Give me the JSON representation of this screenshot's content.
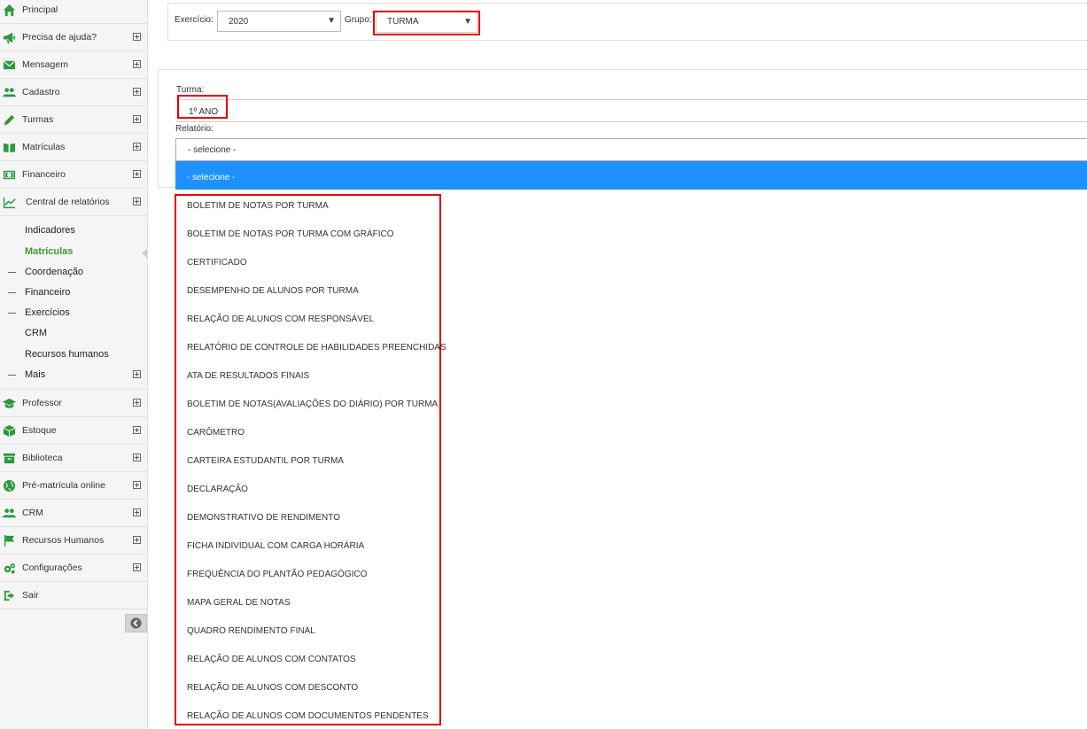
{
  "sidebar": {
    "items": [
      {
        "label": "Principal",
        "icon": "home-icon",
        "expandable": false
      },
      {
        "label": "Precisa de ajuda?",
        "icon": "megaphone-icon",
        "expandable": true
      },
      {
        "label": "Mensagem",
        "icon": "envelope-icon",
        "expandable": true
      },
      {
        "label": "Cadastro",
        "icon": "users-icon",
        "expandable": true
      },
      {
        "label": "Turmas",
        "icon": "pencil-icon",
        "expandable": true
      },
      {
        "label": "Matrículas",
        "icon": "book-icon",
        "expandable": true
      },
      {
        "label": "Financeiro",
        "icon": "money-icon",
        "expandable": true
      },
      {
        "label": "Central de relatórios",
        "icon": "line-chart-icon",
        "expandable": true
      }
    ],
    "subitems": [
      {
        "label": "Indicadores",
        "active": false,
        "dash": false
      },
      {
        "label": "Matrículas",
        "active": true,
        "dash": false
      },
      {
        "label": "Coordenação",
        "active": false,
        "dash": true
      },
      {
        "label": "Financeiro",
        "active": false,
        "dash": true
      },
      {
        "label": "Exercícios",
        "active": false,
        "dash": true
      },
      {
        "label": "CRM",
        "active": false,
        "dash": false
      },
      {
        "label": "Recursos humanos",
        "active": false,
        "dash": false
      },
      {
        "label": "Mais",
        "active": false,
        "dash": true
      }
    ],
    "items_bottom": [
      {
        "label": "Professor",
        "icon": "graduation-cap-icon",
        "expandable": true
      },
      {
        "label": "Estoque",
        "icon": "cube-icon",
        "expandable": true
      },
      {
        "label": "Biblioteca",
        "icon": "archive-icon",
        "expandable": true
      },
      {
        "label": "Pré-matrícula online",
        "icon": "globe-icon",
        "expandable": true
      },
      {
        "label": "CRM",
        "icon": "users-icon",
        "expandable": true
      },
      {
        "label": "Recursos Humanos",
        "icon": "flag-icon",
        "expandable": true
      },
      {
        "label": "Configurações",
        "icon": "gears-icon",
        "expandable": true
      },
      {
        "label": "Sair",
        "icon": "sign-out-icon",
        "expandable": false
      }
    ]
  },
  "filters": {
    "exercicio_label": "Exercício:",
    "exercicio_value": "2020",
    "grupo_label": "Grupo:",
    "grupo_value": "TURMA"
  },
  "form": {
    "turma_label": "Turma:",
    "turma_value": "1º ANO",
    "relatorio_label": "Relatório:",
    "relatorio_value": "- selecione -"
  },
  "dropdown": {
    "selected": "- selecione -",
    "options": [
      "BOLETIM DE NOTAS POR TURMA",
      "BOLETIM DE NOTAS POR TURMA COM GRÁFICO",
      "CERTIFICADO",
      "DESEMPENHO DE ALUNOS POR TURMA",
      "RELAÇÃO DE ALUNOS COM RESPONSÁVEL",
      "RELATÓRIO DE CONTROLE DE HABILIDADES PREENCHIDAS",
      "ATA DE RESULTADOS FINAIS",
      "BOLETIM DE NOTAS(AVALIAÇÕES DO DIÁRIO) POR TURMA",
      "CARÔMETRO",
      "CARTEIRA ESTUDANTIL POR TURMA",
      "DECLARAÇÃO",
      "DEMONSTRATIVO DE RENDIMENTO",
      "FICHA INDIVIDUAL COM CARGA HORÁRIA",
      "FREQUÊNCIA DO PLANTÃO PEDAGÓGICO",
      "MAPA GERAL DE NOTAS",
      "QUADRO RENDIMENTO FINAL",
      "RELAÇÃO DE ALUNOS COM CONTATOS",
      "RELAÇÃO DE ALUNOS COM DESCONTO",
      "RELAÇÃO DE ALUNOS COM DOCUMENTOS PENDENTES"
    ]
  },
  "colors": {
    "accent_green": "#2a9a3c",
    "active_green": "#3a9a2b",
    "highlight_blue": "#1e90ff",
    "annotation_red": "#e00000"
  }
}
